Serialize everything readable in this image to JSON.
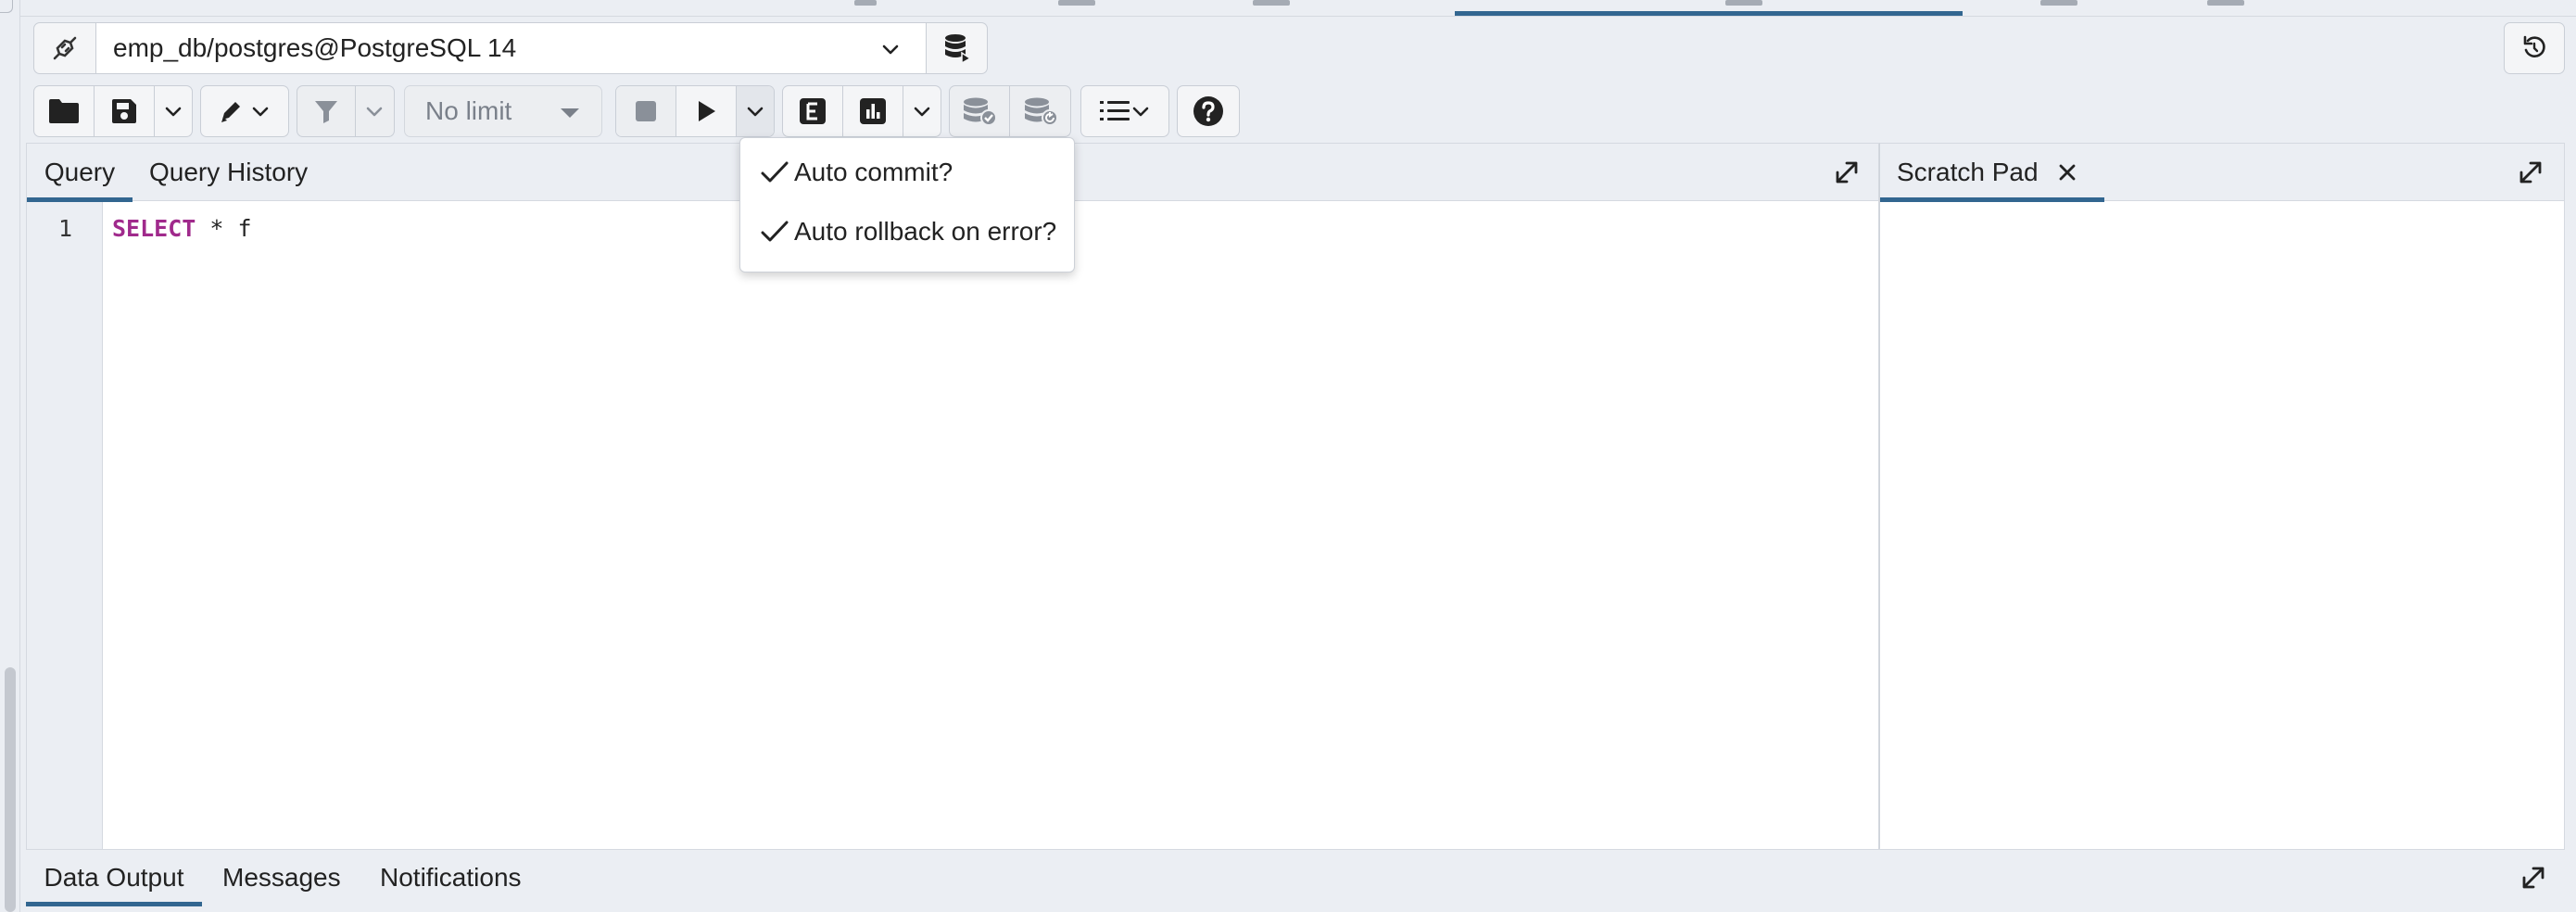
{
  "connection": {
    "selected": "emp_db/postgres@PostgreSQL 14"
  },
  "toolbar": {
    "limit_label": "No limit"
  },
  "query_panel": {
    "tabs": [
      {
        "label": "Query",
        "active": true
      },
      {
        "label": "Query History",
        "active": false
      }
    ]
  },
  "editor": {
    "line_number": "1",
    "keyword": "SELECT",
    "rest": " * f"
  },
  "scratch_pad": {
    "tab_label": "Scratch Pad"
  },
  "dropdown": {
    "items": [
      {
        "label": "Auto commit?",
        "checked": true
      },
      {
        "label": "Auto rollback on error?",
        "checked": true
      }
    ]
  },
  "bottom_tabs": [
    {
      "label": "Data Output",
      "active": true
    },
    {
      "label": "Messages",
      "active": false
    },
    {
      "label": "Notifications",
      "active": false
    }
  ],
  "colors": {
    "accent": "#326690",
    "keyword": "#a02a8c"
  }
}
